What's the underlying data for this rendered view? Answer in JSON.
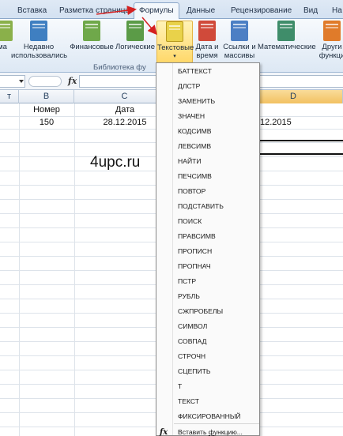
{
  "ribbon_tabs": [
    "Вставка",
    "Разметка страницы",
    "Формулы",
    "Данные",
    "Рецензирование",
    "Вид",
    "На"
  ],
  "ribbon_buttons": [
    {
      "label1": "ма",
      "label2": "",
      "icon": "partial-icon",
      "color": "#8ab04a"
    },
    {
      "label1": "Недавно",
      "label2": "использовались",
      "icon": "recent-book-icon",
      "color": "#3f7fc1"
    },
    {
      "label1": "Финансовые",
      "label2": "",
      "icon": "finance-book-icon",
      "color": "#6fa84a"
    },
    {
      "label1": "Логические",
      "label2": "",
      "icon": "logical-book-icon",
      "color": "#5b9b47"
    },
    {
      "label1": "Текстовые",
      "label2": "",
      "icon": "text-book-icon",
      "color": "#e9d24a"
    },
    {
      "label1": "Дата и",
      "label2": "время",
      "icon": "datetime-book-icon",
      "color": "#d04a3a"
    },
    {
      "label1": "Ссылки и",
      "label2": "массивы",
      "icon": "lookup-book-icon",
      "color": "#4c7fc4"
    },
    {
      "label1": "Математические",
      "label2": "",
      "icon": "math-book-icon",
      "color": "#3f8d6a"
    },
    {
      "label1": "Други",
      "label2": "функци",
      "icon": "more-book-icon",
      "color": "#e07b2a"
    }
  ],
  "ribbon_group_label": "Библиотека фу",
  "formula_bar": {
    "fx": "fx"
  },
  "columns": [
    "т",
    "B",
    "C",
    "D"
  ],
  "row1": {
    "b": "Номер",
    "c": "Дата"
  },
  "row2": {
    "b": "150",
    "c": "28.12.2015",
    "d": "12.2015"
  },
  "watermark": "4upc.ru",
  "menu_items": [
    "БАТТЕКСТ",
    "ДЛСТР",
    "ЗАМЕНИТЬ",
    "ЗНАЧЕН",
    "КОДСИМВ",
    "ЛЕВСИМВ",
    "НАЙТИ",
    "ПЕЧСИМВ",
    "ПОВТОР",
    "ПОДСТАВИТЬ",
    "ПОИСК",
    "ПРАВСИМВ",
    "ПРОПИСН",
    "ПРОПНАЧ",
    "ПСТР",
    "РУБЛЬ",
    "СЖПРОБЕЛЫ",
    "СИМВОЛ",
    "СОВПАД",
    "СТРОЧН",
    "СЦЕПИТЬ",
    "Т",
    "ТЕКСТ",
    "ФИКСИРОВАННЫЙ"
  ],
  "insert_function": {
    "before": "Вставить ",
    "underlined": "ф",
    "after": "ункцию..."
  },
  "colors": {
    "arrow": "#d42020",
    "ribbon_bg": "#dde8f4",
    "selected_col": "#f2c161"
  }
}
